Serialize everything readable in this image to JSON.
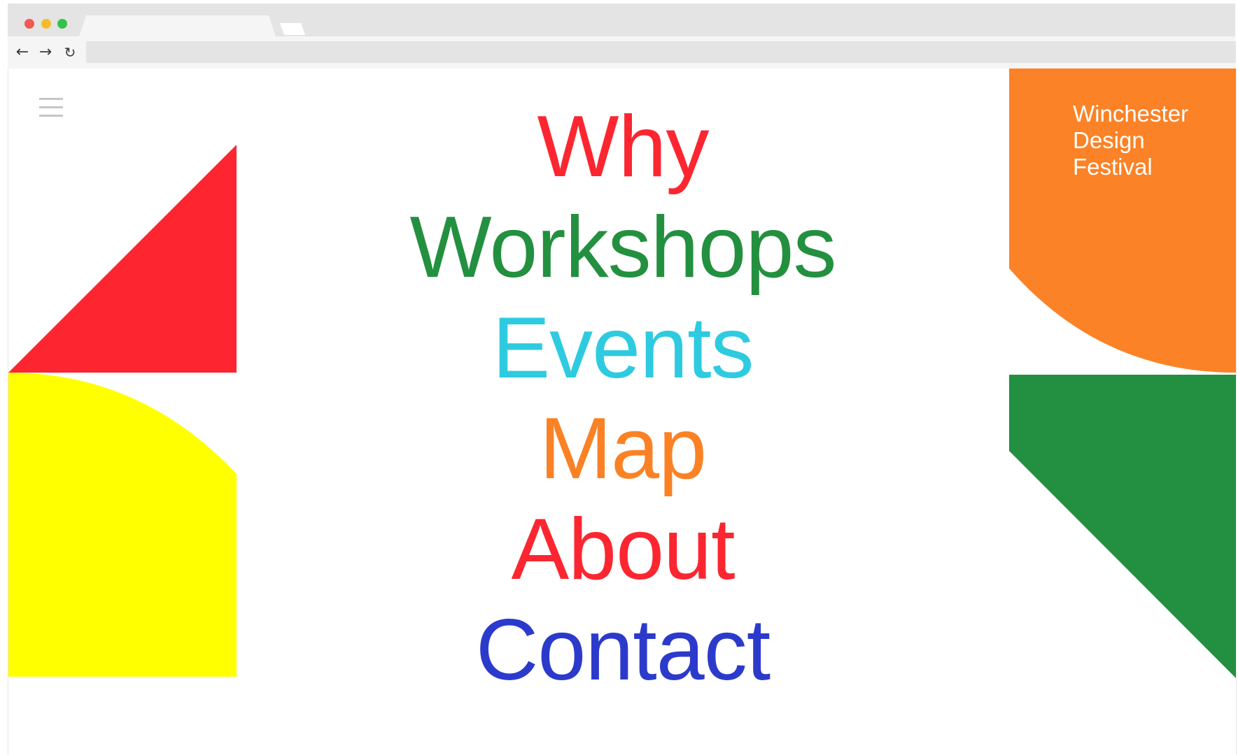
{
  "browser": {
    "back_icon": "arrow-left-icon",
    "forward_icon": "arrow-right-icon",
    "reload_icon": "reload-icon",
    "url": ""
  },
  "site": {
    "menu_icon": "hamburger-menu-icon",
    "brand_lines": [
      "Winchester",
      "Design",
      "Festival"
    ],
    "nav": [
      {
        "label": "Why",
        "color": "#fc2630"
      },
      {
        "label": "Workshops",
        "color": "#23903f"
      },
      {
        "label": "Events",
        "color": "#2ecbe0"
      },
      {
        "label": "Map",
        "color": "#fb8125"
      },
      {
        "label": "About",
        "color": "#fc2630"
      },
      {
        "label": "Contact",
        "color": "#2c3acc"
      }
    ],
    "colors": {
      "red": "#fd2530",
      "yellow": "#ffff00",
      "orange": "#fb8226",
      "green": "#238f40"
    }
  }
}
